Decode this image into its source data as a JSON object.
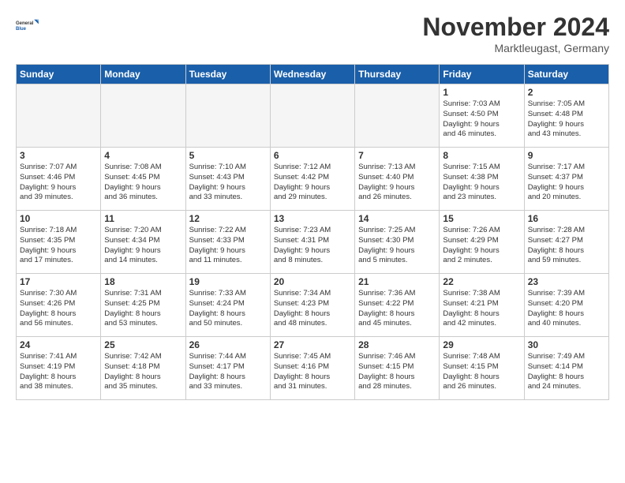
{
  "logo": {
    "line1": "General",
    "line2": "Blue"
  },
  "title": "November 2024",
  "location": "Marktleugast, Germany",
  "weekdays": [
    "Sunday",
    "Monday",
    "Tuesday",
    "Wednesday",
    "Thursday",
    "Friday",
    "Saturday"
  ],
  "weeks": [
    [
      {
        "day": "",
        "info": ""
      },
      {
        "day": "",
        "info": ""
      },
      {
        "day": "",
        "info": ""
      },
      {
        "day": "",
        "info": ""
      },
      {
        "day": "",
        "info": ""
      },
      {
        "day": "1",
        "info": "Sunrise: 7:03 AM\nSunset: 4:50 PM\nDaylight: 9 hours\nand 46 minutes."
      },
      {
        "day": "2",
        "info": "Sunrise: 7:05 AM\nSunset: 4:48 PM\nDaylight: 9 hours\nand 43 minutes."
      }
    ],
    [
      {
        "day": "3",
        "info": "Sunrise: 7:07 AM\nSunset: 4:46 PM\nDaylight: 9 hours\nand 39 minutes."
      },
      {
        "day": "4",
        "info": "Sunrise: 7:08 AM\nSunset: 4:45 PM\nDaylight: 9 hours\nand 36 minutes."
      },
      {
        "day": "5",
        "info": "Sunrise: 7:10 AM\nSunset: 4:43 PM\nDaylight: 9 hours\nand 33 minutes."
      },
      {
        "day": "6",
        "info": "Sunrise: 7:12 AM\nSunset: 4:42 PM\nDaylight: 9 hours\nand 29 minutes."
      },
      {
        "day": "7",
        "info": "Sunrise: 7:13 AM\nSunset: 4:40 PM\nDaylight: 9 hours\nand 26 minutes."
      },
      {
        "day": "8",
        "info": "Sunrise: 7:15 AM\nSunset: 4:38 PM\nDaylight: 9 hours\nand 23 minutes."
      },
      {
        "day": "9",
        "info": "Sunrise: 7:17 AM\nSunset: 4:37 PM\nDaylight: 9 hours\nand 20 minutes."
      }
    ],
    [
      {
        "day": "10",
        "info": "Sunrise: 7:18 AM\nSunset: 4:35 PM\nDaylight: 9 hours\nand 17 minutes."
      },
      {
        "day": "11",
        "info": "Sunrise: 7:20 AM\nSunset: 4:34 PM\nDaylight: 9 hours\nand 14 minutes."
      },
      {
        "day": "12",
        "info": "Sunrise: 7:22 AM\nSunset: 4:33 PM\nDaylight: 9 hours\nand 11 minutes."
      },
      {
        "day": "13",
        "info": "Sunrise: 7:23 AM\nSunset: 4:31 PM\nDaylight: 9 hours\nand 8 minutes."
      },
      {
        "day": "14",
        "info": "Sunrise: 7:25 AM\nSunset: 4:30 PM\nDaylight: 9 hours\nand 5 minutes."
      },
      {
        "day": "15",
        "info": "Sunrise: 7:26 AM\nSunset: 4:29 PM\nDaylight: 9 hours\nand 2 minutes."
      },
      {
        "day": "16",
        "info": "Sunrise: 7:28 AM\nSunset: 4:27 PM\nDaylight: 8 hours\nand 59 minutes."
      }
    ],
    [
      {
        "day": "17",
        "info": "Sunrise: 7:30 AM\nSunset: 4:26 PM\nDaylight: 8 hours\nand 56 minutes."
      },
      {
        "day": "18",
        "info": "Sunrise: 7:31 AM\nSunset: 4:25 PM\nDaylight: 8 hours\nand 53 minutes."
      },
      {
        "day": "19",
        "info": "Sunrise: 7:33 AM\nSunset: 4:24 PM\nDaylight: 8 hours\nand 50 minutes."
      },
      {
        "day": "20",
        "info": "Sunrise: 7:34 AM\nSunset: 4:23 PM\nDaylight: 8 hours\nand 48 minutes."
      },
      {
        "day": "21",
        "info": "Sunrise: 7:36 AM\nSunset: 4:22 PM\nDaylight: 8 hours\nand 45 minutes."
      },
      {
        "day": "22",
        "info": "Sunrise: 7:38 AM\nSunset: 4:21 PM\nDaylight: 8 hours\nand 42 minutes."
      },
      {
        "day": "23",
        "info": "Sunrise: 7:39 AM\nSunset: 4:20 PM\nDaylight: 8 hours\nand 40 minutes."
      }
    ],
    [
      {
        "day": "24",
        "info": "Sunrise: 7:41 AM\nSunset: 4:19 PM\nDaylight: 8 hours\nand 38 minutes."
      },
      {
        "day": "25",
        "info": "Sunrise: 7:42 AM\nSunset: 4:18 PM\nDaylight: 8 hours\nand 35 minutes."
      },
      {
        "day": "26",
        "info": "Sunrise: 7:44 AM\nSunset: 4:17 PM\nDaylight: 8 hours\nand 33 minutes."
      },
      {
        "day": "27",
        "info": "Sunrise: 7:45 AM\nSunset: 4:16 PM\nDaylight: 8 hours\nand 31 minutes."
      },
      {
        "day": "28",
        "info": "Sunrise: 7:46 AM\nSunset: 4:15 PM\nDaylight: 8 hours\nand 28 minutes."
      },
      {
        "day": "29",
        "info": "Sunrise: 7:48 AM\nSunset: 4:15 PM\nDaylight: 8 hours\nand 26 minutes."
      },
      {
        "day": "30",
        "info": "Sunrise: 7:49 AM\nSunset: 4:14 PM\nDaylight: 8 hours\nand 24 minutes."
      }
    ]
  ]
}
